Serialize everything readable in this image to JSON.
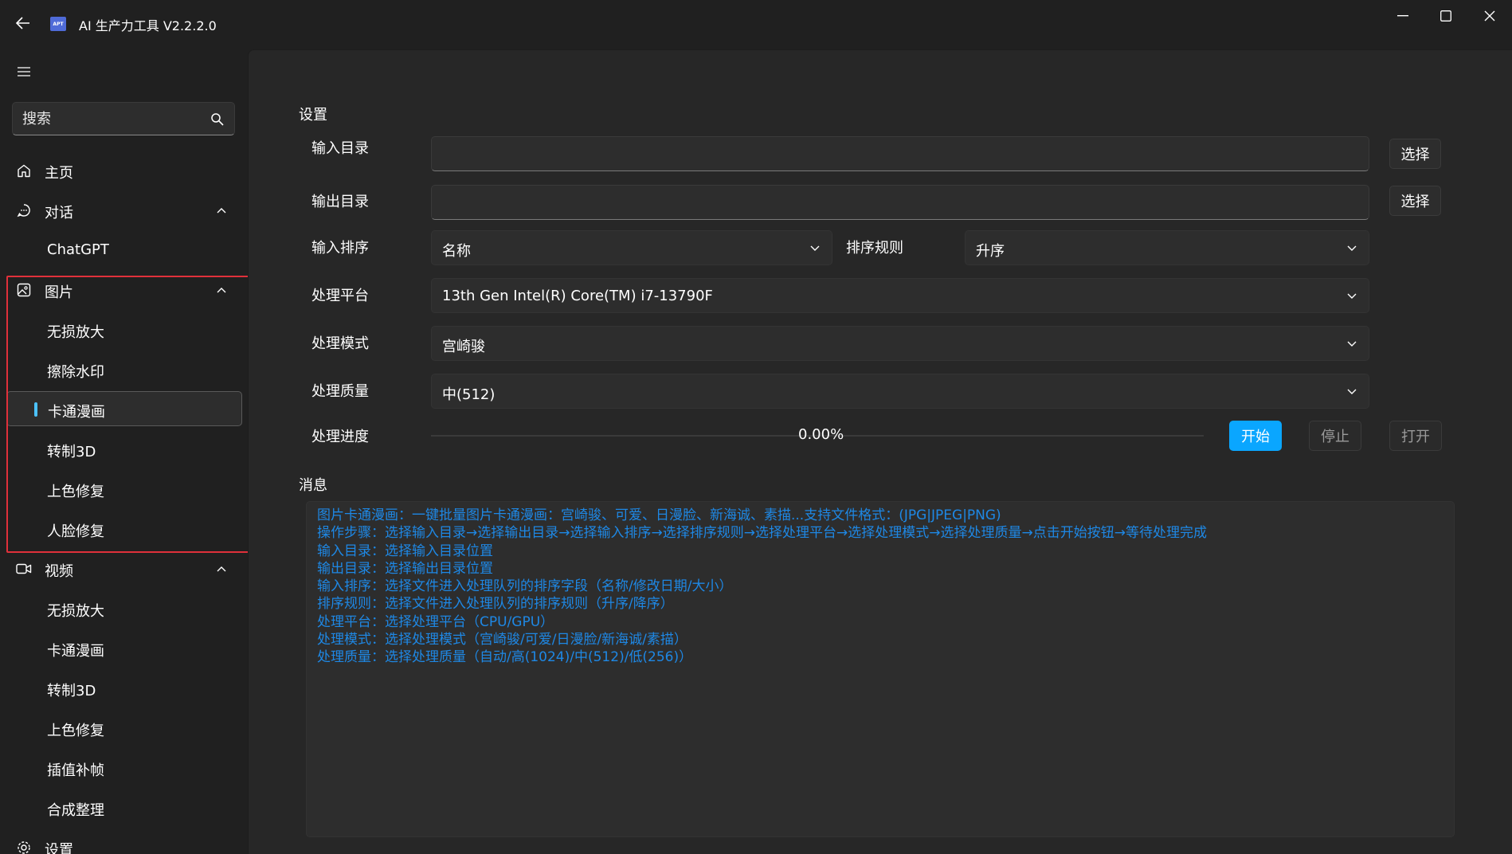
{
  "window": {
    "title": "AI 生产力工具 V2.2.2.0",
    "logo_text": "APT",
    "accent_color": "#0aa6ff",
    "highlight_color": "#e0303a",
    "message_color": "#1e88e5"
  },
  "sidebar": {
    "search_placeholder": "搜索",
    "items": {
      "home": "主页",
      "chat": "对话",
      "chat_gpt": "ChatGPT",
      "image": "图片",
      "image_upscale": "无损放大",
      "image_watermark": "擦除水印",
      "image_cartoon": "卡通漫画",
      "image_3d": "转制3D",
      "image_colorize": "上色修复",
      "image_face": "人脸修复",
      "video": "视频",
      "video_upscale": "无损放大",
      "video_cartoon": "卡通漫画",
      "video_3d": "转制3D",
      "video_colorize": "上色修复",
      "video_interp": "插值补帧",
      "video_compose": "合成整理",
      "settings": "设置"
    },
    "selected": "卡通漫画"
  },
  "main": {
    "settings_title": "设置",
    "input_dir_label": "输入目录",
    "input_dir_value": "",
    "output_dir_label": "输出目录",
    "output_dir_value": "",
    "choose_label": "选择",
    "sort_label": "输入排序",
    "sort_value": "名称",
    "rule_label": "排序规则",
    "rule_value": "升序",
    "platform_label": "处理平台",
    "platform_value": "13th Gen Intel(R) Core(TM) i7-13790F",
    "mode_label": "处理模式",
    "mode_value": "宫崎骏",
    "quality_label": "处理质量",
    "quality_value": "中(512)",
    "progress_label": "处理进度",
    "progress_value": 0.0,
    "progress_text": "0.00%",
    "start_label": "开始",
    "stop_label": "停止",
    "open_label": "打开",
    "messages_title": "消息",
    "messages": [
      "图片卡通漫画：一键批量图片卡通漫画：宫崎骏、可爱、日漫脸、新海诚、素描...支持文件格式：(JPG|JPEG|PNG)",
      "操作步骤：选择输入目录→选择输出目录→选择输入排序→选择排序规则→选择处理平台→选择处理模式→选择处理质量→点击开始按钮→等待处理完成",
      "输入目录：选择输入目录位置",
      "输出目录：选择输出目录位置",
      "输入排序：选择文件进入处理队列的排序字段（名称/修改日期/大小）",
      "排序规则：选择文件进入处理队列的排序规则（升序/降序）",
      "处理平台：选择处理平台（CPU/GPU）",
      "处理模式：选择处理模式（宫崎骏/可爱/日漫脸/新海诚/素描）",
      "处理质量：选择处理质量（自动/高(1024)/中(512)/低(256)）"
    ]
  }
}
